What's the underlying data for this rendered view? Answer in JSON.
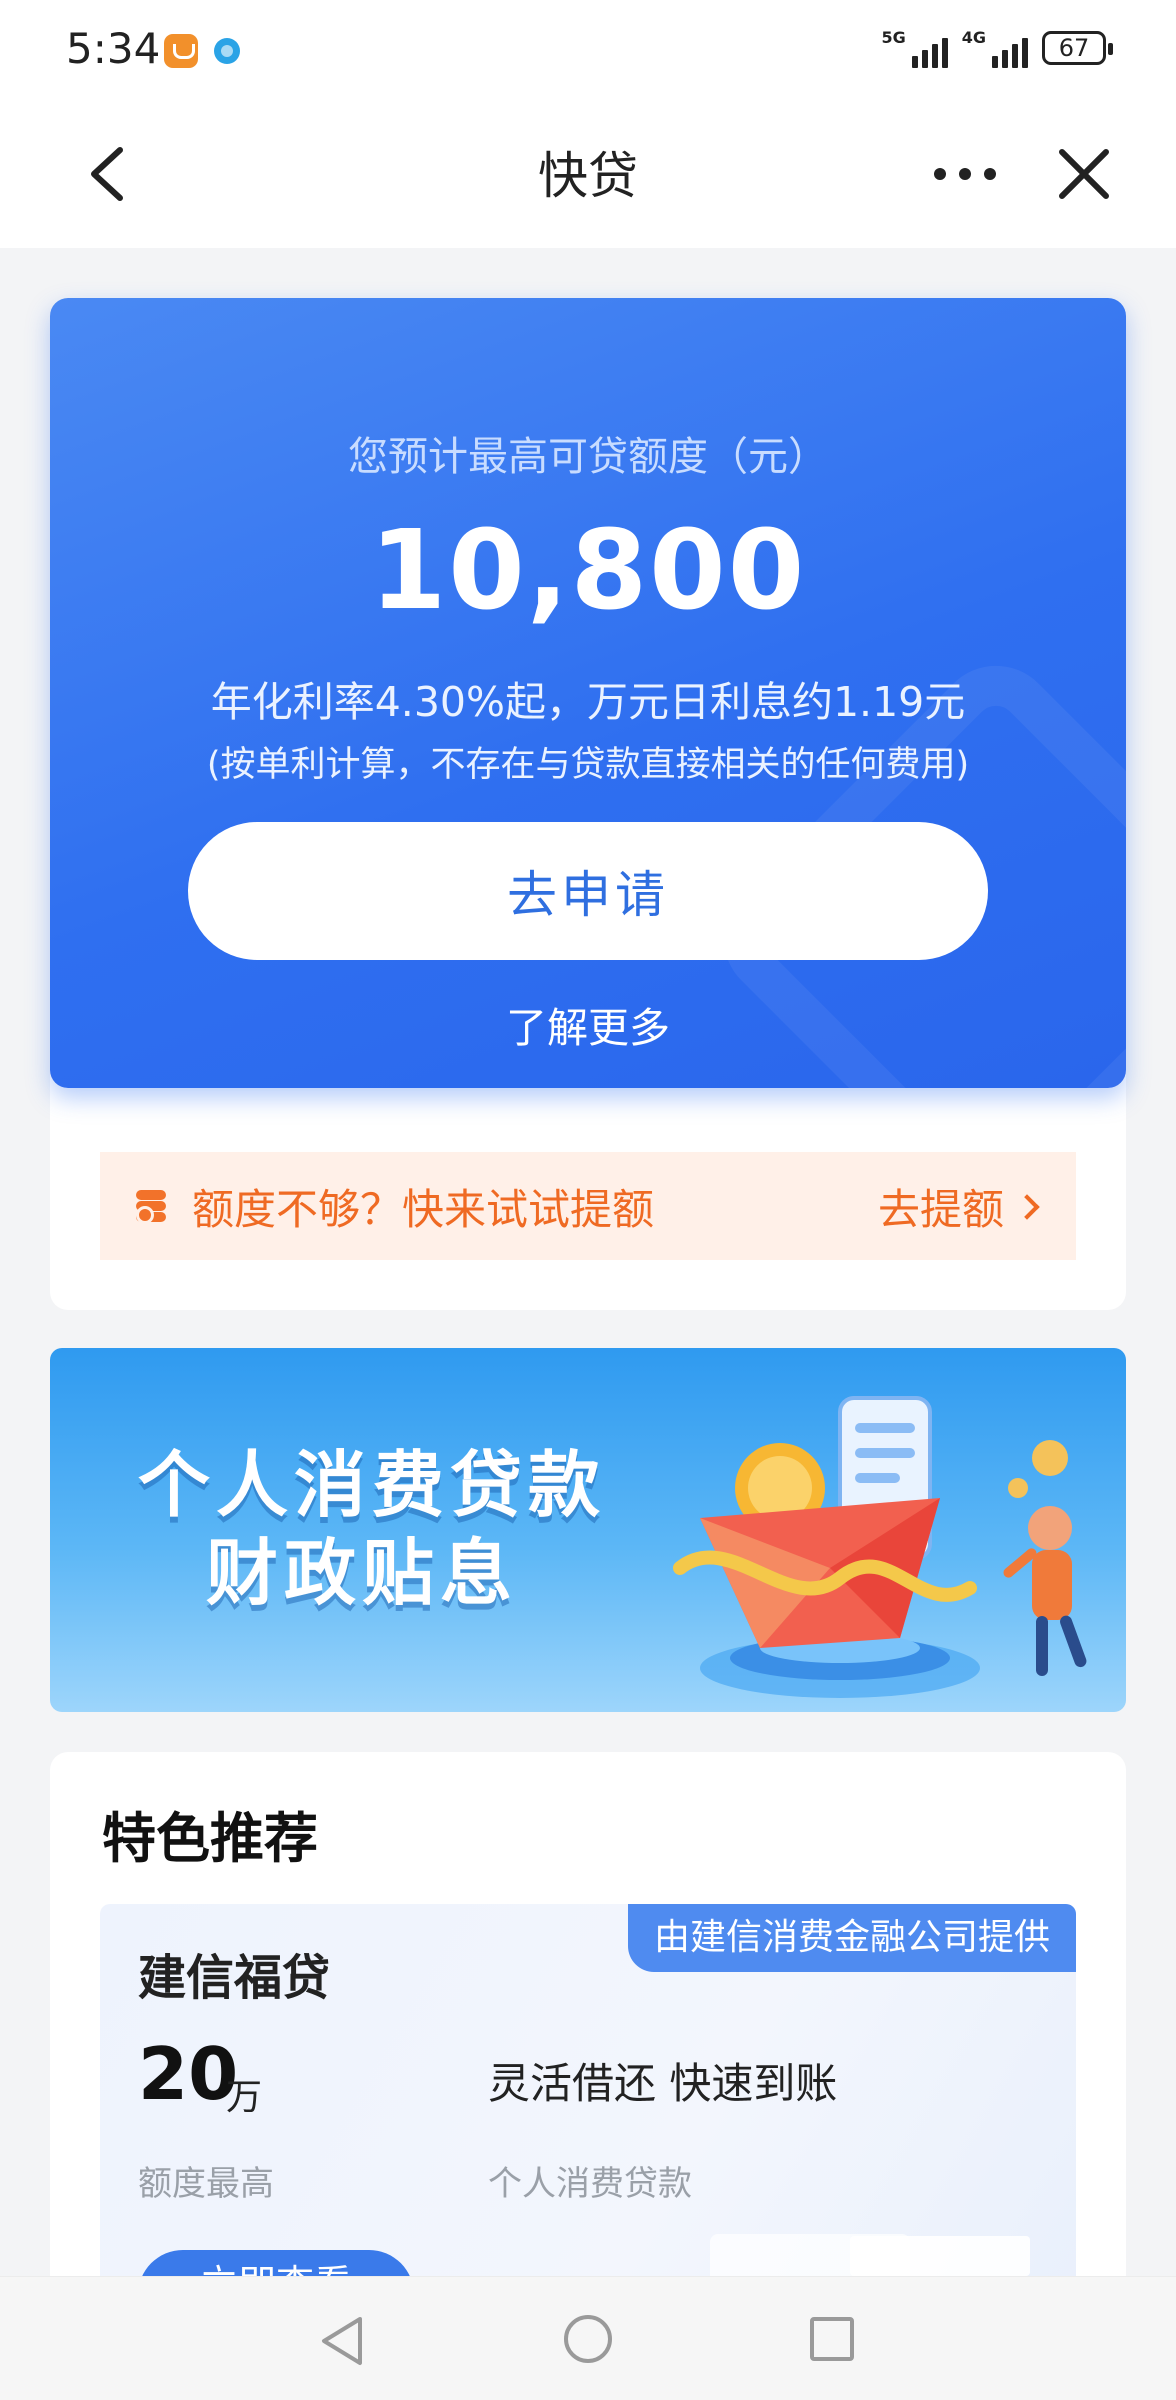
{
  "status_bar": {
    "time": "5:34",
    "network1": "5G",
    "network2": "4G",
    "battery": "67"
  },
  "nav": {
    "title": "快贷",
    "back_icon": "chevron-left-icon",
    "more_icon": "more-dots-icon",
    "close_icon": "close-icon"
  },
  "hero": {
    "label": "您预计最高可贷额度（元）",
    "amount": "10,800",
    "rate": "年化利率4.30%起，万元日利息约1.19元",
    "note": "(按单利计算，不存在与贷款直接相关的任何费用)",
    "apply_label": "去申请",
    "more_label": "了解更多"
  },
  "quota": {
    "icon": "coins-up-icon",
    "text": "额度不够？快来试试提额",
    "link_label": "去提额"
  },
  "banner": {
    "line1": "个人消费贷款",
    "line2": "财政贴息"
  },
  "featured": {
    "title": "特色推荐",
    "product": {
      "provider": "由建信消费金融公司提供",
      "name": "建信福贷",
      "amount": "20",
      "unit": "万",
      "amount_caption": "额度最高",
      "tagline": "灵活借还 快速到账",
      "category": "个人消费贷款",
      "button_label": "立即查看"
    }
  },
  "colors": {
    "primary_blue": "#2f6ff0",
    "accent_orange": "#ef6a23",
    "page_background": "#f3f4f6"
  }
}
